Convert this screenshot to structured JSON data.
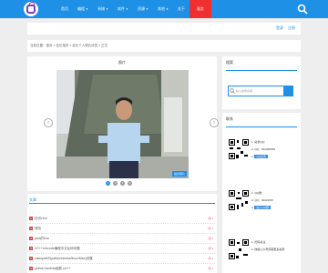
{
  "nav": {
    "items": [
      {
        "label": "首页",
        "caret": ""
      },
      {
        "label": "编程",
        "caret": "▼"
      },
      {
        "label": "系统",
        "caret": "▼"
      },
      {
        "label": "软件",
        "caret": "▼"
      },
      {
        "label": "资源",
        "caret": "▼"
      },
      {
        "label": "其他",
        "caret": "▼"
      },
      {
        "label": "关于",
        "caret": ""
      }
    ],
    "active_label": "留言"
  },
  "userbar": {
    "login": "登录",
    "register": "注册"
  },
  "breadcrumb": "当前位置：首页 » 站长相关 » 站长个人照片欣赏 » 正文",
  "main": {
    "title": "照片",
    "caption": "站长照片",
    "prev": "‹",
    "next": "›",
    "dots": [
      "1",
      "2",
      "3",
      "4"
    ]
  },
  "list": {
    "title": "文章",
    "rows": [
      {
        "num": "1",
        "text": "初识chm",
        "meta": "阅 1"
      },
      {
        "num": "2",
        "text": "修改",
        "meta": "阅 1"
      },
      {
        "num": "3",
        "text": "java的Doc",
        "meta": "阅 1"
      },
      {
        "num": "4",
        "text": "VC++Unicode编程中文乱码问题",
        "meta": "阅 3"
      },
      {
        "num": "5",
        "text": "classpath与path(windows/linux/Mac)设置",
        "meta": "阅 2"
      },
      {
        "num": "6",
        "text": "python lambda函数 c/c++",
        "meta": "阅 1"
      }
    ]
  },
  "search_box": {
    "title": "搜索",
    "placeholder": "输入搜索内容"
  },
  "qq_box": {
    "title": "联系",
    "line1": "1. 站长QQ：",
    "line2": "2. QQ：542395356",
    "line3_prefix": "3.",
    "qq_button_1": "QQ交谈",
    "line4": "1. QQ群：",
    "line5": "2. QQ：92222067",
    "qq_button_2": "加入QQ群"
  },
  "wechat_box": {
    "line1": "1. 扫码关注",
    "line2": "2. 微信公众号获取更多资源"
  }
}
